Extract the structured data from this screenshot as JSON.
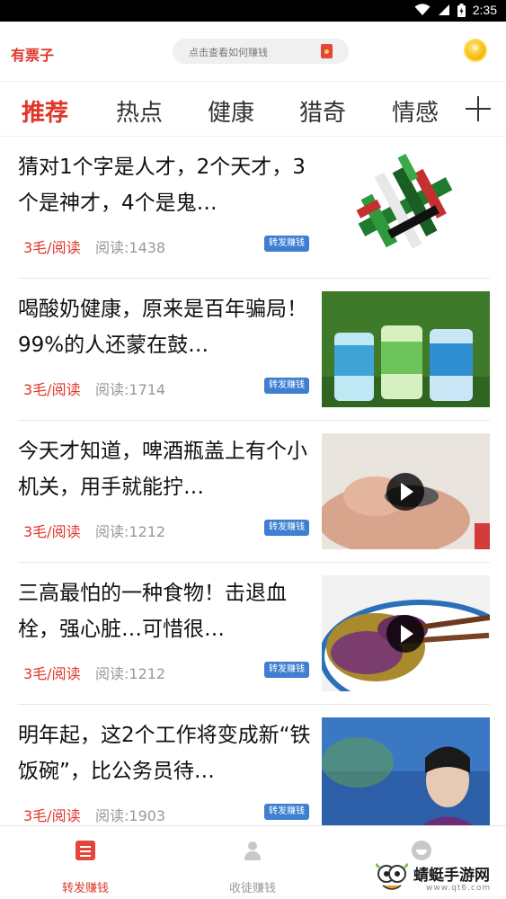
{
  "status_bar": {
    "time": "2:35"
  },
  "header": {
    "brand": "有票子",
    "search_placeholder": "点击查看如何赚钱",
    "coin_symbol": "¥"
  },
  "tabs": {
    "items": [
      {
        "label": "推荐",
        "active": true
      },
      {
        "label": "热点",
        "active": false
      },
      {
        "label": "健康",
        "active": false
      },
      {
        "label": "猎奇",
        "active": false
      },
      {
        "label": "情感",
        "active": false
      }
    ],
    "add_icon": "plus-icon"
  },
  "feed": {
    "items": [
      {
        "title": "猜对1个字是人才，2个天才，3个是神才，4个是鬼…",
        "price": "3毛/阅读",
        "reads": "阅读:1438",
        "share_label": "转发赚钱",
        "thumbnail": "green-red-pixel-puzzle",
        "video": false
      },
      {
        "title": "喝酸奶健康，原来是百年骗局！99%的人还蒙在鼓…",
        "price": "3毛/阅读",
        "reads": "阅读:1714",
        "share_label": "转发赚钱",
        "thumbnail": "yogurt-cups-on-grass",
        "video": false
      },
      {
        "title": "今天才知道，啤酒瓶盖上有个小机关，用手就能拧…",
        "price": "3毛/阅读",
        "reads": "阅读:1212",
        "share_label": "转发赚钱",
        "thumbnail": "hand-with-bottle-cap",
        "video": true
      },
      {
        "title": "三高最怕的一种食物！击退血栓，强心脏…可惜很…",
        "price": "3毛/阅读",
        "reads": "阅读:1212",
        "share_label": "转发赚钱",
        "thumbnail": "eggplant-dish-with-chopsticks",
        "video": true
      },
      {
        "title": "明年起，这2个工作将变成新“铁饭碗”，比公务员待…",
        "price": "3毛/阅读",
        "reads": "阅读:1903",
        "share_label": "转发赚钱",
        "thumbnail": "news-anchor-in-studio",
        "video": false
      }
    ]
  },
  "bottom_nav": {
    "items": [
      {
        "label": "转发赚钱",
        "icon": "news-icon",
        "active": true
      },
      {
        "label": "收徒赚钱",
        "icon": "user-icon",
        "active": false
      },
      {
        "label": "",
        "icon": "profile-icon",
        "active": false
      }
    ]
  },
  "watermark": {
    "text": "蜻蜓手游网",
    "url": "www.qt6.com"
  },
  "colors": {
    "accent": "#e0352b",
    "share_badge": "#3f7fd2",
    "muted": "#999999"
  }
}
